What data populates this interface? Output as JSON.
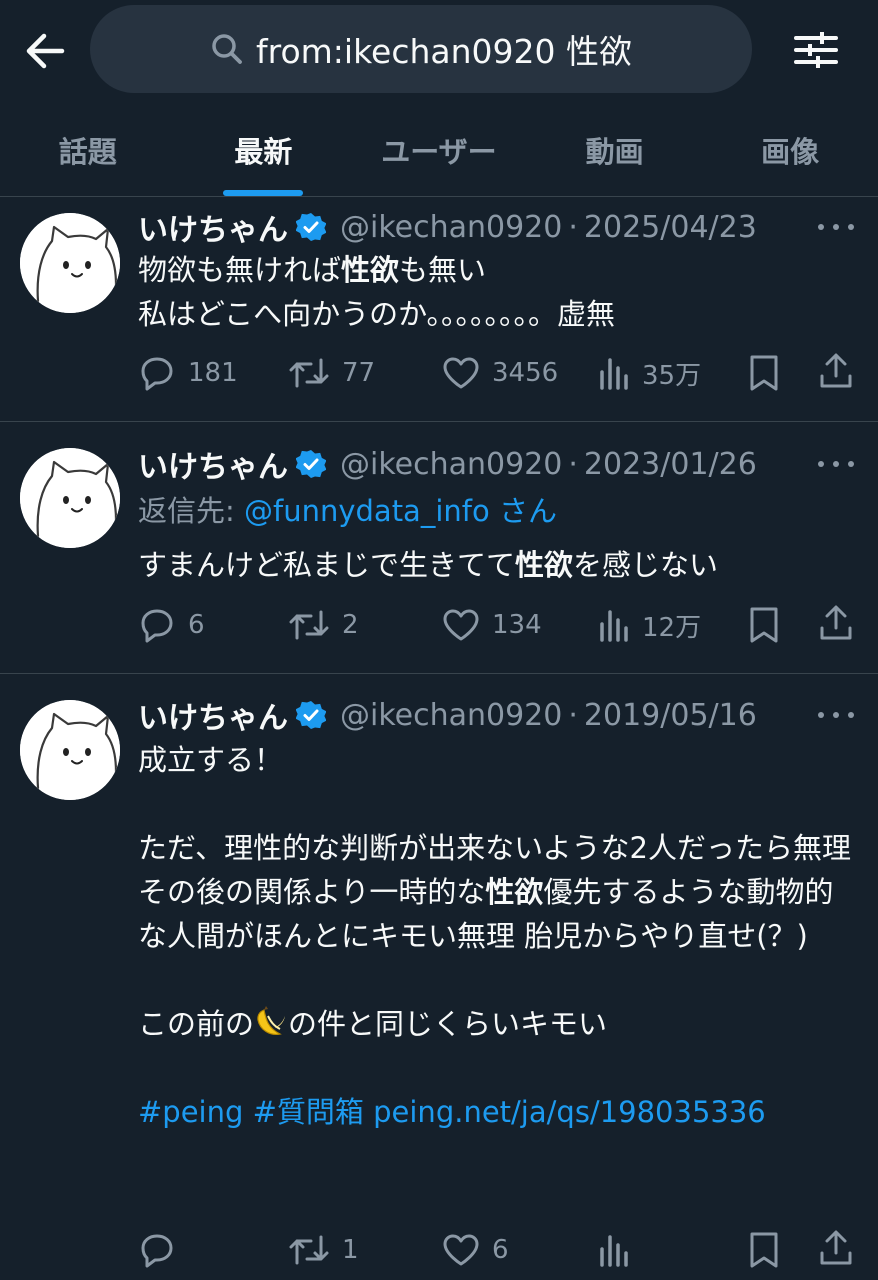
{
  "search": {
    "query": "from:ikechan0920 性欲"
  },
  "tabs": [
    "話題",
    "最新",
    "ユーザー",
    "動画",
    "画像"
  ],
  "active_tab": "最新",
  "colors": {
    "background": "#15202b",
    "accent": "#1d9bf0",
    "muted": "#8b98a5",
    "divider": "#38444d"
  },
  "tweets": [
    {
      "name": "いけちゃん",
      "handle": "@ikechan0920",
      "date": "2025/04/23",
      "lines": [
        {
          "before": "物欲も無ければ",
          "bold": "性欲",
          "after": "も無い"
        },
        {
          "before": "私はどこへ向かうのか。。。。。。。。虚無",
          "bold": "",
          "after": ""
        }
      ],
      "stats": {
        "replies": "181",
        "retweets": "77",
        "likes": "3456",
        "views": "35万"
      }
    },
    {
      "name": "いけちゃん",
      "handle": "@ikechan0920",
      "date": "2023/01/26",
      "reply_label": "返信先: ",
      "reply_user": "@funnydata_info さん",
      "lines": [
        {
          "before": "すまんけど私まじで生きてて",
          "bold": "性欲",
          "after": "を感じない"
        }
      ],
      "stats": {
        "replies": "6",
        "retweets": "2",
        "likes": "134",
        "views": "12万"
      }
    },
    {
      "name": "いけちゃん",
      "handle": "@ikechan0920",
      "date": "2019/05/16",
      "lines": [
        {
          "before": "成立する！",
          "bold": "",
          "after": ""
        },
        {
          "before": "ただ、理性的な判断が出来ないような2人だったら無理",
          "bold": "",
          "after": ""
        },
        {
          "before": "その後の関係より一時的な",
          "bold": "性欲",
          "after": "優先するような動物的な人間がほんとにキモい無理 胎児からやり直せ(？)"
        },
        {
          "before": "この前の",
          "emoji": "banana",
          "after": "の件と同じくらいキモい"
        }
      ],
      "hashtags": "#peing #質問箱 peing.net/ja/qs/198035336",
      "stats": {
        "replies": "",
        "retweets": "1",
        "likes": "6",
        "views": ""
      }
    }
  ]
}
